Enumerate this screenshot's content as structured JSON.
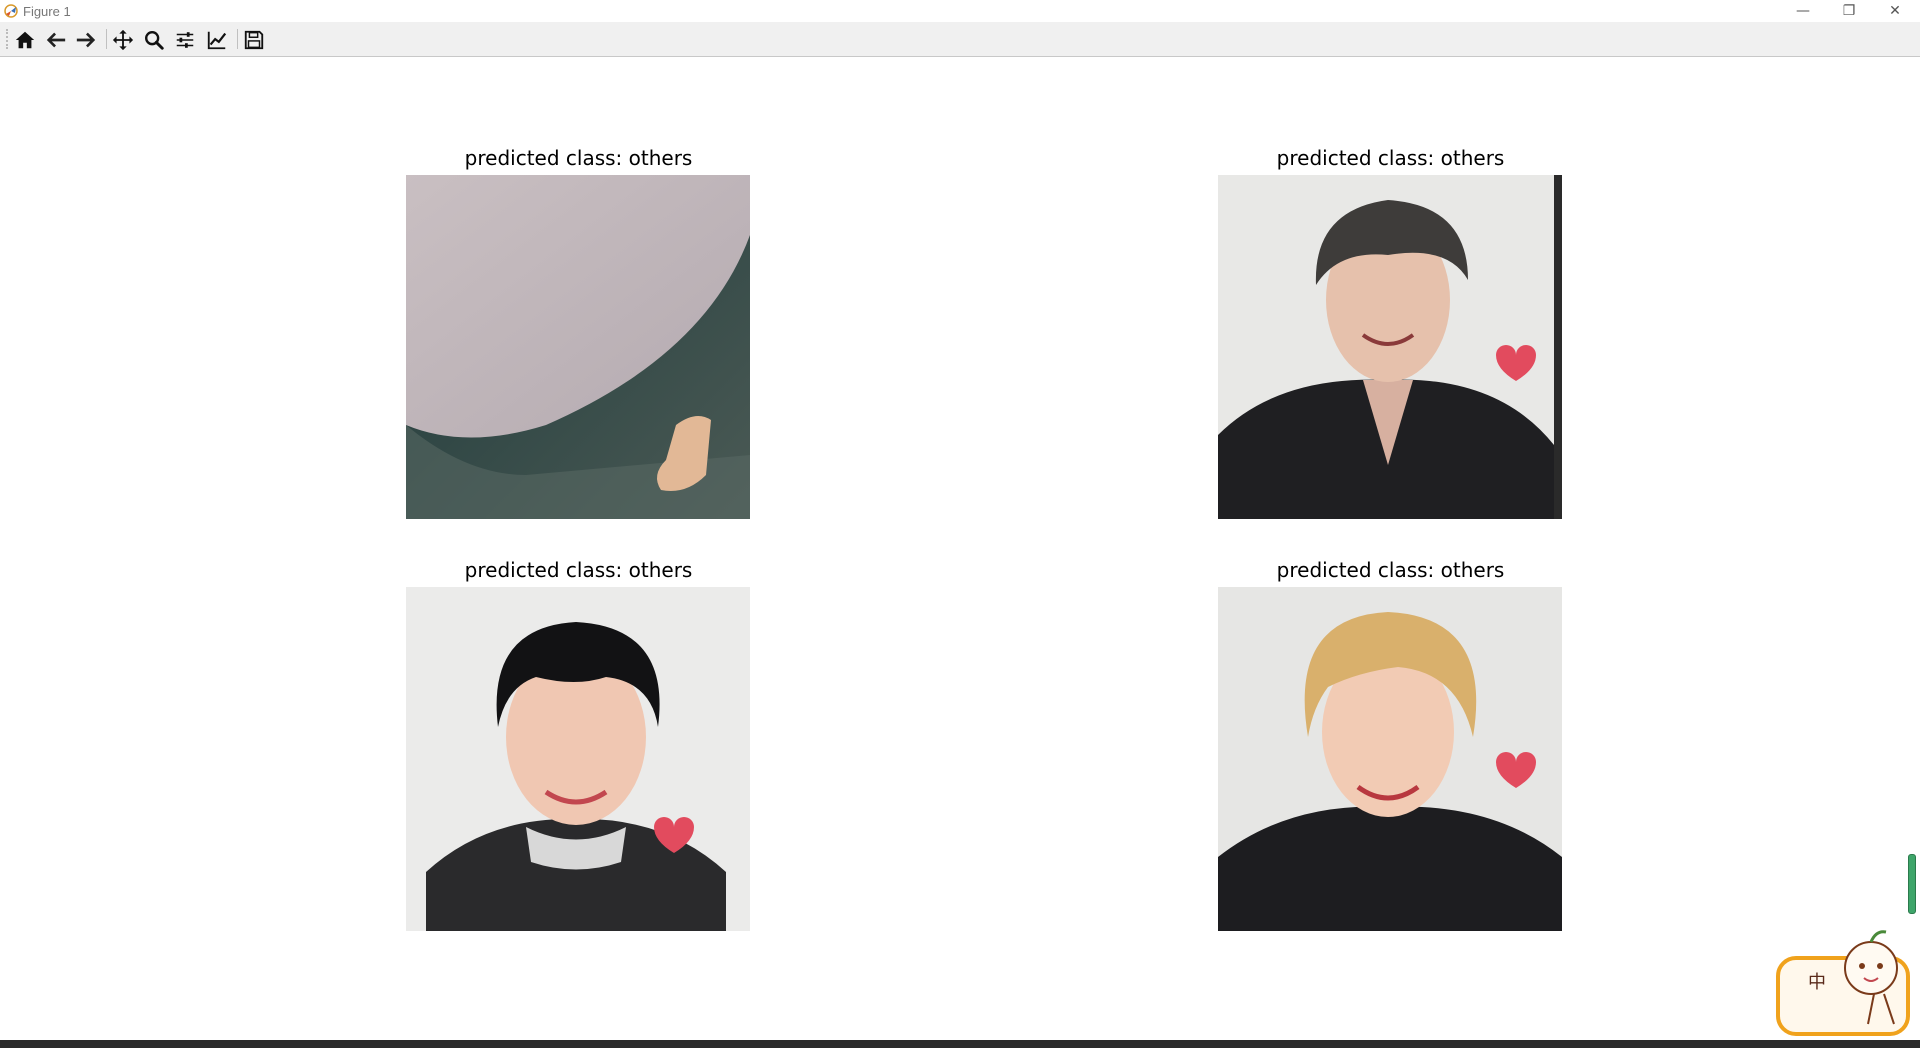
{
  "window": {
    "title": "Figure 1",
    "controls": {
      "minimize": "—",
      "maximize": "❐",
      "close": "✕"
    }
  },
  "toolbar": {
    "buttons": [
      {
        "name": "home",
        "icon": "home-icon"
      },
      {
        "name": "back",
        "icon": "arrow-left-icon"
      },
      {
        "name": "forward",
        "icon": "arrow-right-icon"
      },
      {
        "name": "pan",
        "icon": "move-icon"
      },
      {
        "name": "zoom",
        "icon": "magnifier-icon"
      },
      {
        "name": "configure-subplots",
        "icon": "sliders-icon"
      },
      {
        "name": "edit-axis",
        "icon": "line-chart-icon"
      },
      {
        "name": "save",
        "icon": "floppy-disk-icon"
      }
    ]
  },
  "figure": {
    "subplots": [
      {
        "title": "predicted class: others",
        "image": "close-up photo of pale curved surface with a hand on dark floor"
      },
      {
        "title": "predicted class: others",
        "image": "smiling person with dark hair in black jacket, hearts sticker"
      },
      {
        "title": "predicted class: others",
        "image": "smiling person with black hair, black and white outfit, hearts sticker"
      },
      {
        "title": "predicted class: others",
        "image": "smiling person with blonde hair in black shirt, hearts sticker"
      }
    ]
  },
  "ime": {
    "char": "中"
  },
  "colors": {
    "toolbar_bg": "#f0f0f0",
    "accent_scroll": "#3ea56a",
    "ime_border": "#f0a21c"
  }
}
